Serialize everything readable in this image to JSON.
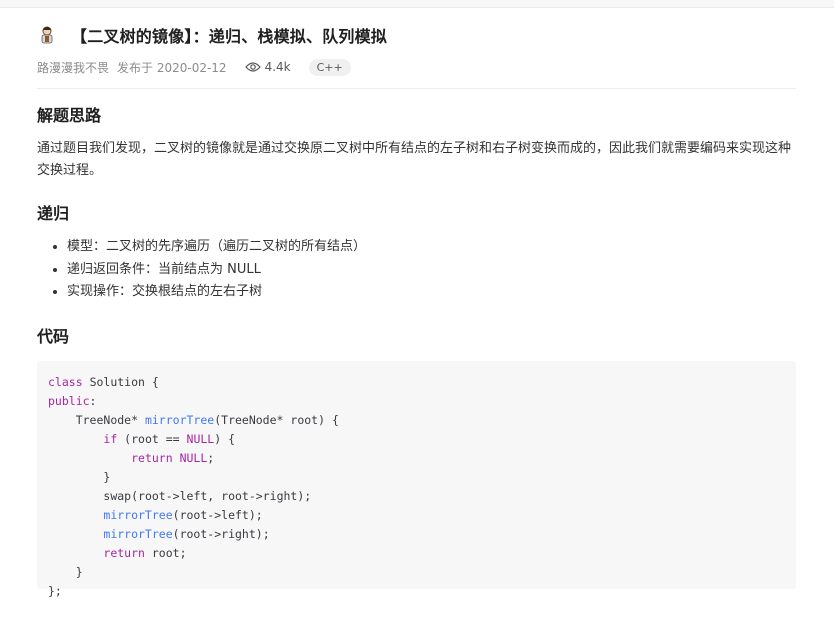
{
  "article": {
    "title": "【二叉树的镜像】：递归、栈模拟、队列模拟",
    "author": "路漫漫我不畏",
    "date": "发布于 2020-02-12",
    "views": "4.4k",
    "tag": "C++"
  },
  "sections": {
    "solve_heading": "解题思路",
    "solve_text": "通过题目我们发现，二叉树的镜像就是通过交换原二叉树中所有结点的左子树和右子树变换而成的，因此我们就需要编码来实现这种交换过程。",
    "recursion_heading": "递归",
    "recursion_points": [
      "模型：二叉树的先序遍历（遍历二叉树的所有结点）",
      "递归返回条件：当前结点为 NULL",
      "实现操作：交换根结点的左右子树"
    ],
    "code_heading": "代码"
  },
  "code": {
    "lines": [
      "class Solution {",
      "public:",
      "    TreeNode* mirrorTree(TreeNode* root) {",
      "        if (root == NULL) {",
      "            return NULL;",
      "        }",
      "        swap(root->left, root->right);",
      "        mirrorTree(root->left);",
      "        mirrorTree(root->right);",
      "        return root;",
      "    }",
      "};"
    ]
  },
  "icons": {
    "avatar": "avatar-icon",
    "views": "eye-icon"
  },
  "colors": {
    "keyword": "#a626a4",
    "function": "#4078f2",
    "code_bg": "#f7f7f7",
    "tag_bg": "#f0f0f0"
  }
}
